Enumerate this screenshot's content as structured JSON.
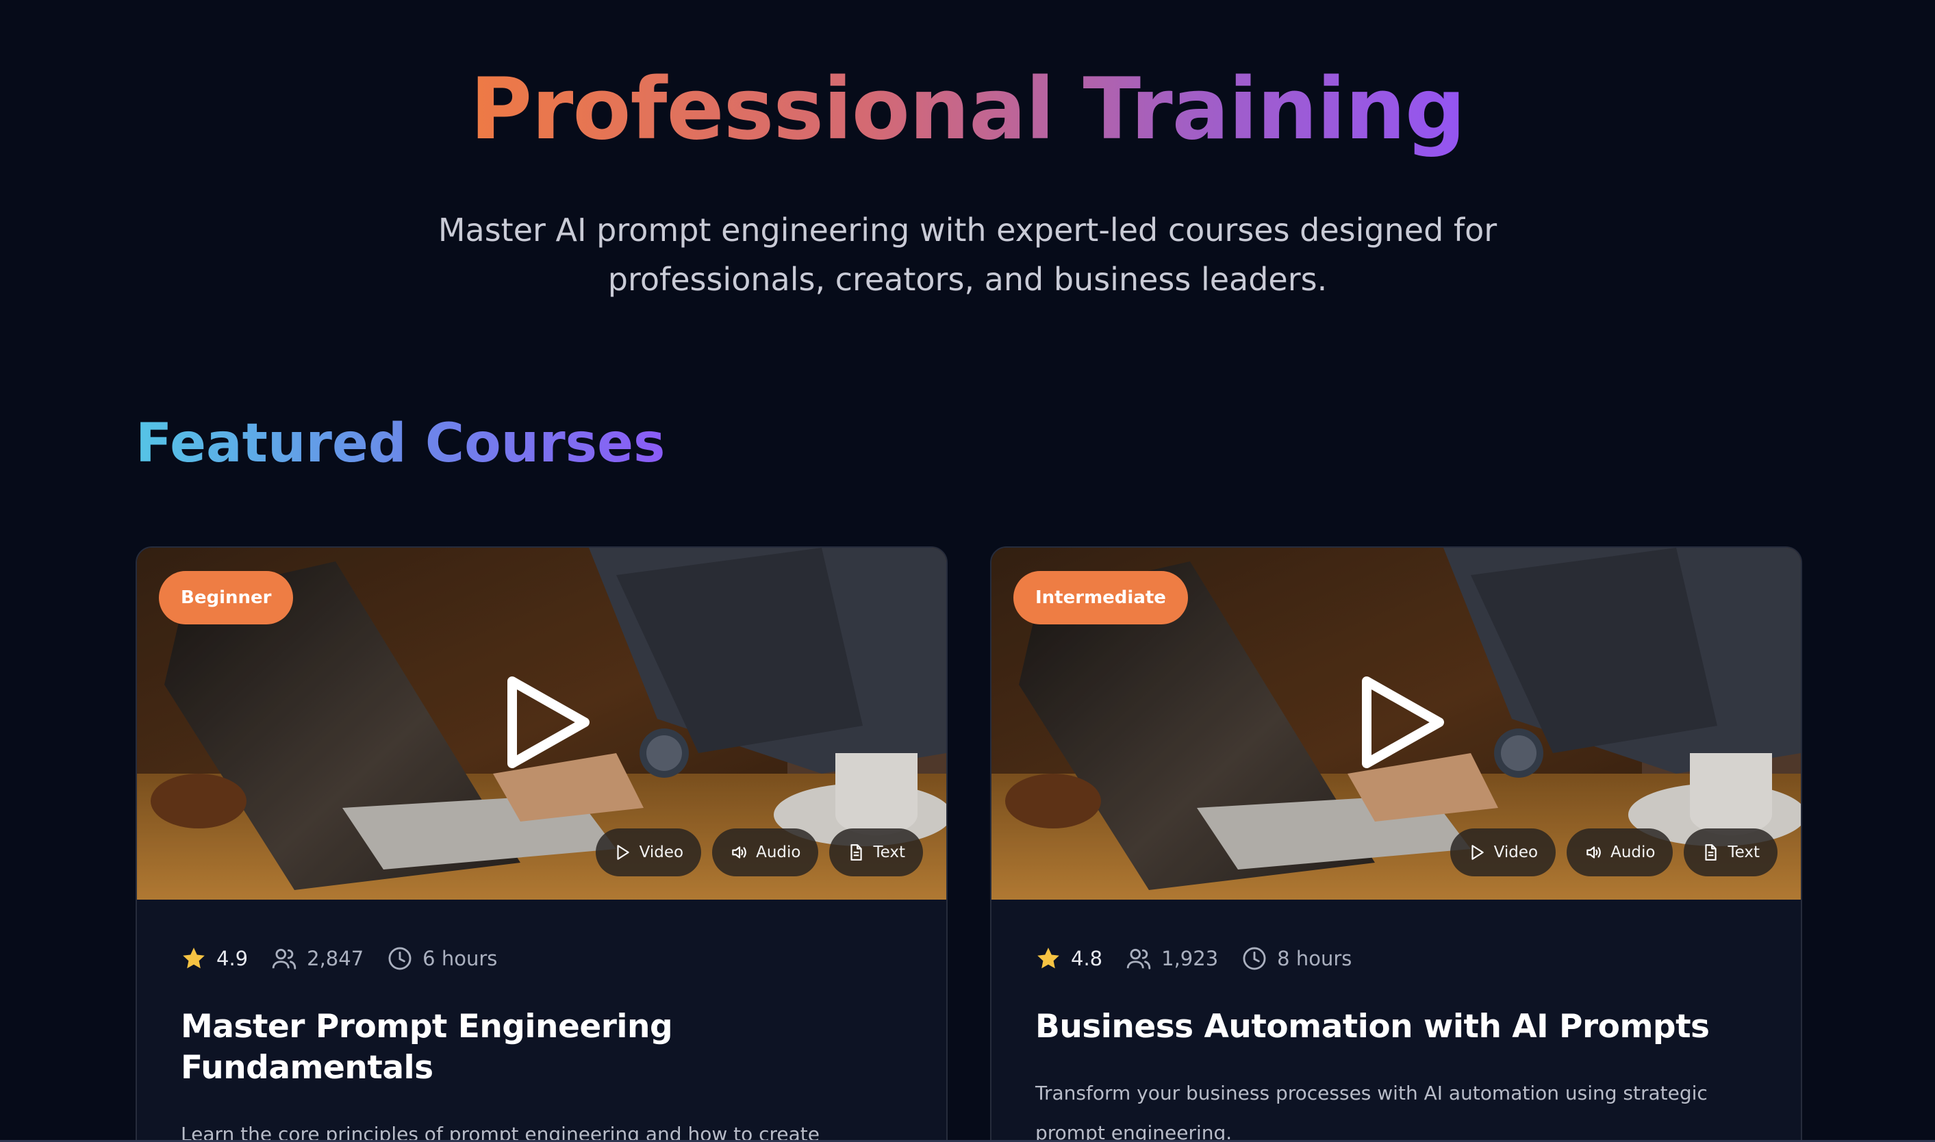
{
  "hero": {
    "title": "Professional Training",
    "subtitle": "Master AI prompt engineering with expert-led courses designed for professionals, creators, and business leaders."
  },
  "featured": {
    "title": "Featured Courses"
  },
  "courses": [
    {
      "level": "Beginner",
      "rating": "4.9",
      "students": "2,847",
      "duration": "6 hours",
      "title": "Master Prompt Engineering Fundamentals",
      "description": "Learn the core principles of prompt engineering and how to create effective prompts for any AI model.",
      "media": {
        "video": "Video",
        "audio": "Audio",
        "text": "Text"
      }
    },
    {
      "level": "Intermediate",
      "rating": "4.8",
      "students": "1,923",
      "duration": "8 hours",
      "title": "Business Automation with AI Prompts",
      "description": "Transform your business processes with AI automation using strategic prompt engineering.",
      "media": {
        "video": "Video",
        "audio": "Audio",
        "text": "Text"
      }
    }
  ],
  "colors": {
    "background": "#060b19",
    "card": "#0d1324",
    "badge": "#ee7d44",
    "star": "#f6c343",
    "title_gradient": [
      "#ee7a45",
      "#9455f2"
    ],
    "section_gradient": [
      "#55c4e6",
      "#8b5cf6"
    ]
  },
  "icons": {
    "rating": "star-icon",
    "students": "users-icon",
    "duration": "clock-icon",
    "play": "play-icon",
    "video": "play-outline-icon",
    "audio": "speaker-icon",
    "text": "document-icon"
  }
}
